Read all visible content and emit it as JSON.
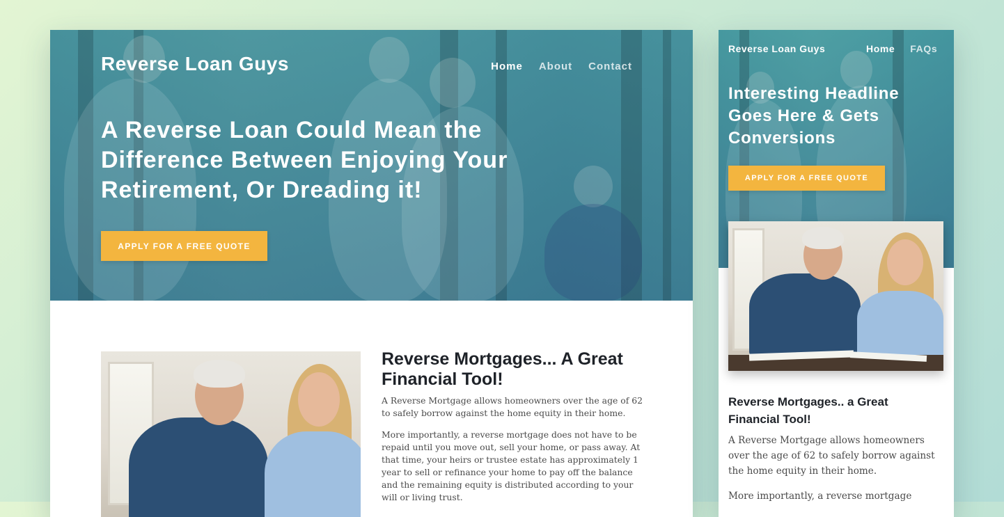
{
  "desktop": {
    "logo": "Reverse Loan Guys",
    "nav": [
      {
        "label": "Home",
        "active": true
      },
      {
        "label": "About",
        "active": false
      },
      {
        "label": "Contact",
        "active": false
      }
    ],
    "hero_title": "A Reverse Loan Could Mean the Difference Between Enjoying Your Retirement, Or Dreading it!",
    "cta_label": "Apply for a free quote",
    "section_title": "Reverse Mortgages... A Great Financial Tool!",
    "paragraphs": [
      "A Reverse Mortgage allows homeowners over the age of 62 to safely borrow against the home equity in their home.",
      "More importantly, a reverse mortgage does not have to be repaid until you move out, sell your home, or pass away. At that time, your heirs or trustee estate has approximately 1 year to sell or refinance your home to pay off the balance and the remaining equity is distributed according to your will or living trust."
    ]
  },
  "mobile": {
    "logo": "Reverse Loan Guys",
    "nav": [
      {
        "label": "Home",
        "active": true
      },
      {
        "label": "FAQs",
        "active": false
      }
    ],
    "hero_title": "Interesting Headline Goes Here & Gets Conversions",
    "cta_label": "Apply for a free quote",
    "section_title": "Reverse Mortgages.. a Great Financial Tool!",
    "paragraphs": [
      "A Reverse Mortgage allows homeowners over the age of 62 to safely borrow against the home equity in their home.",
      "More importantly, a reverse mortgage"
    ]
  },
  "colors": {
    "cta": "#f3b53f",
    "hero_overlay": "#4aa0af",
    "heading_text": "#1e2228",
    "body_text": "#4a4a4a"
  }
}
